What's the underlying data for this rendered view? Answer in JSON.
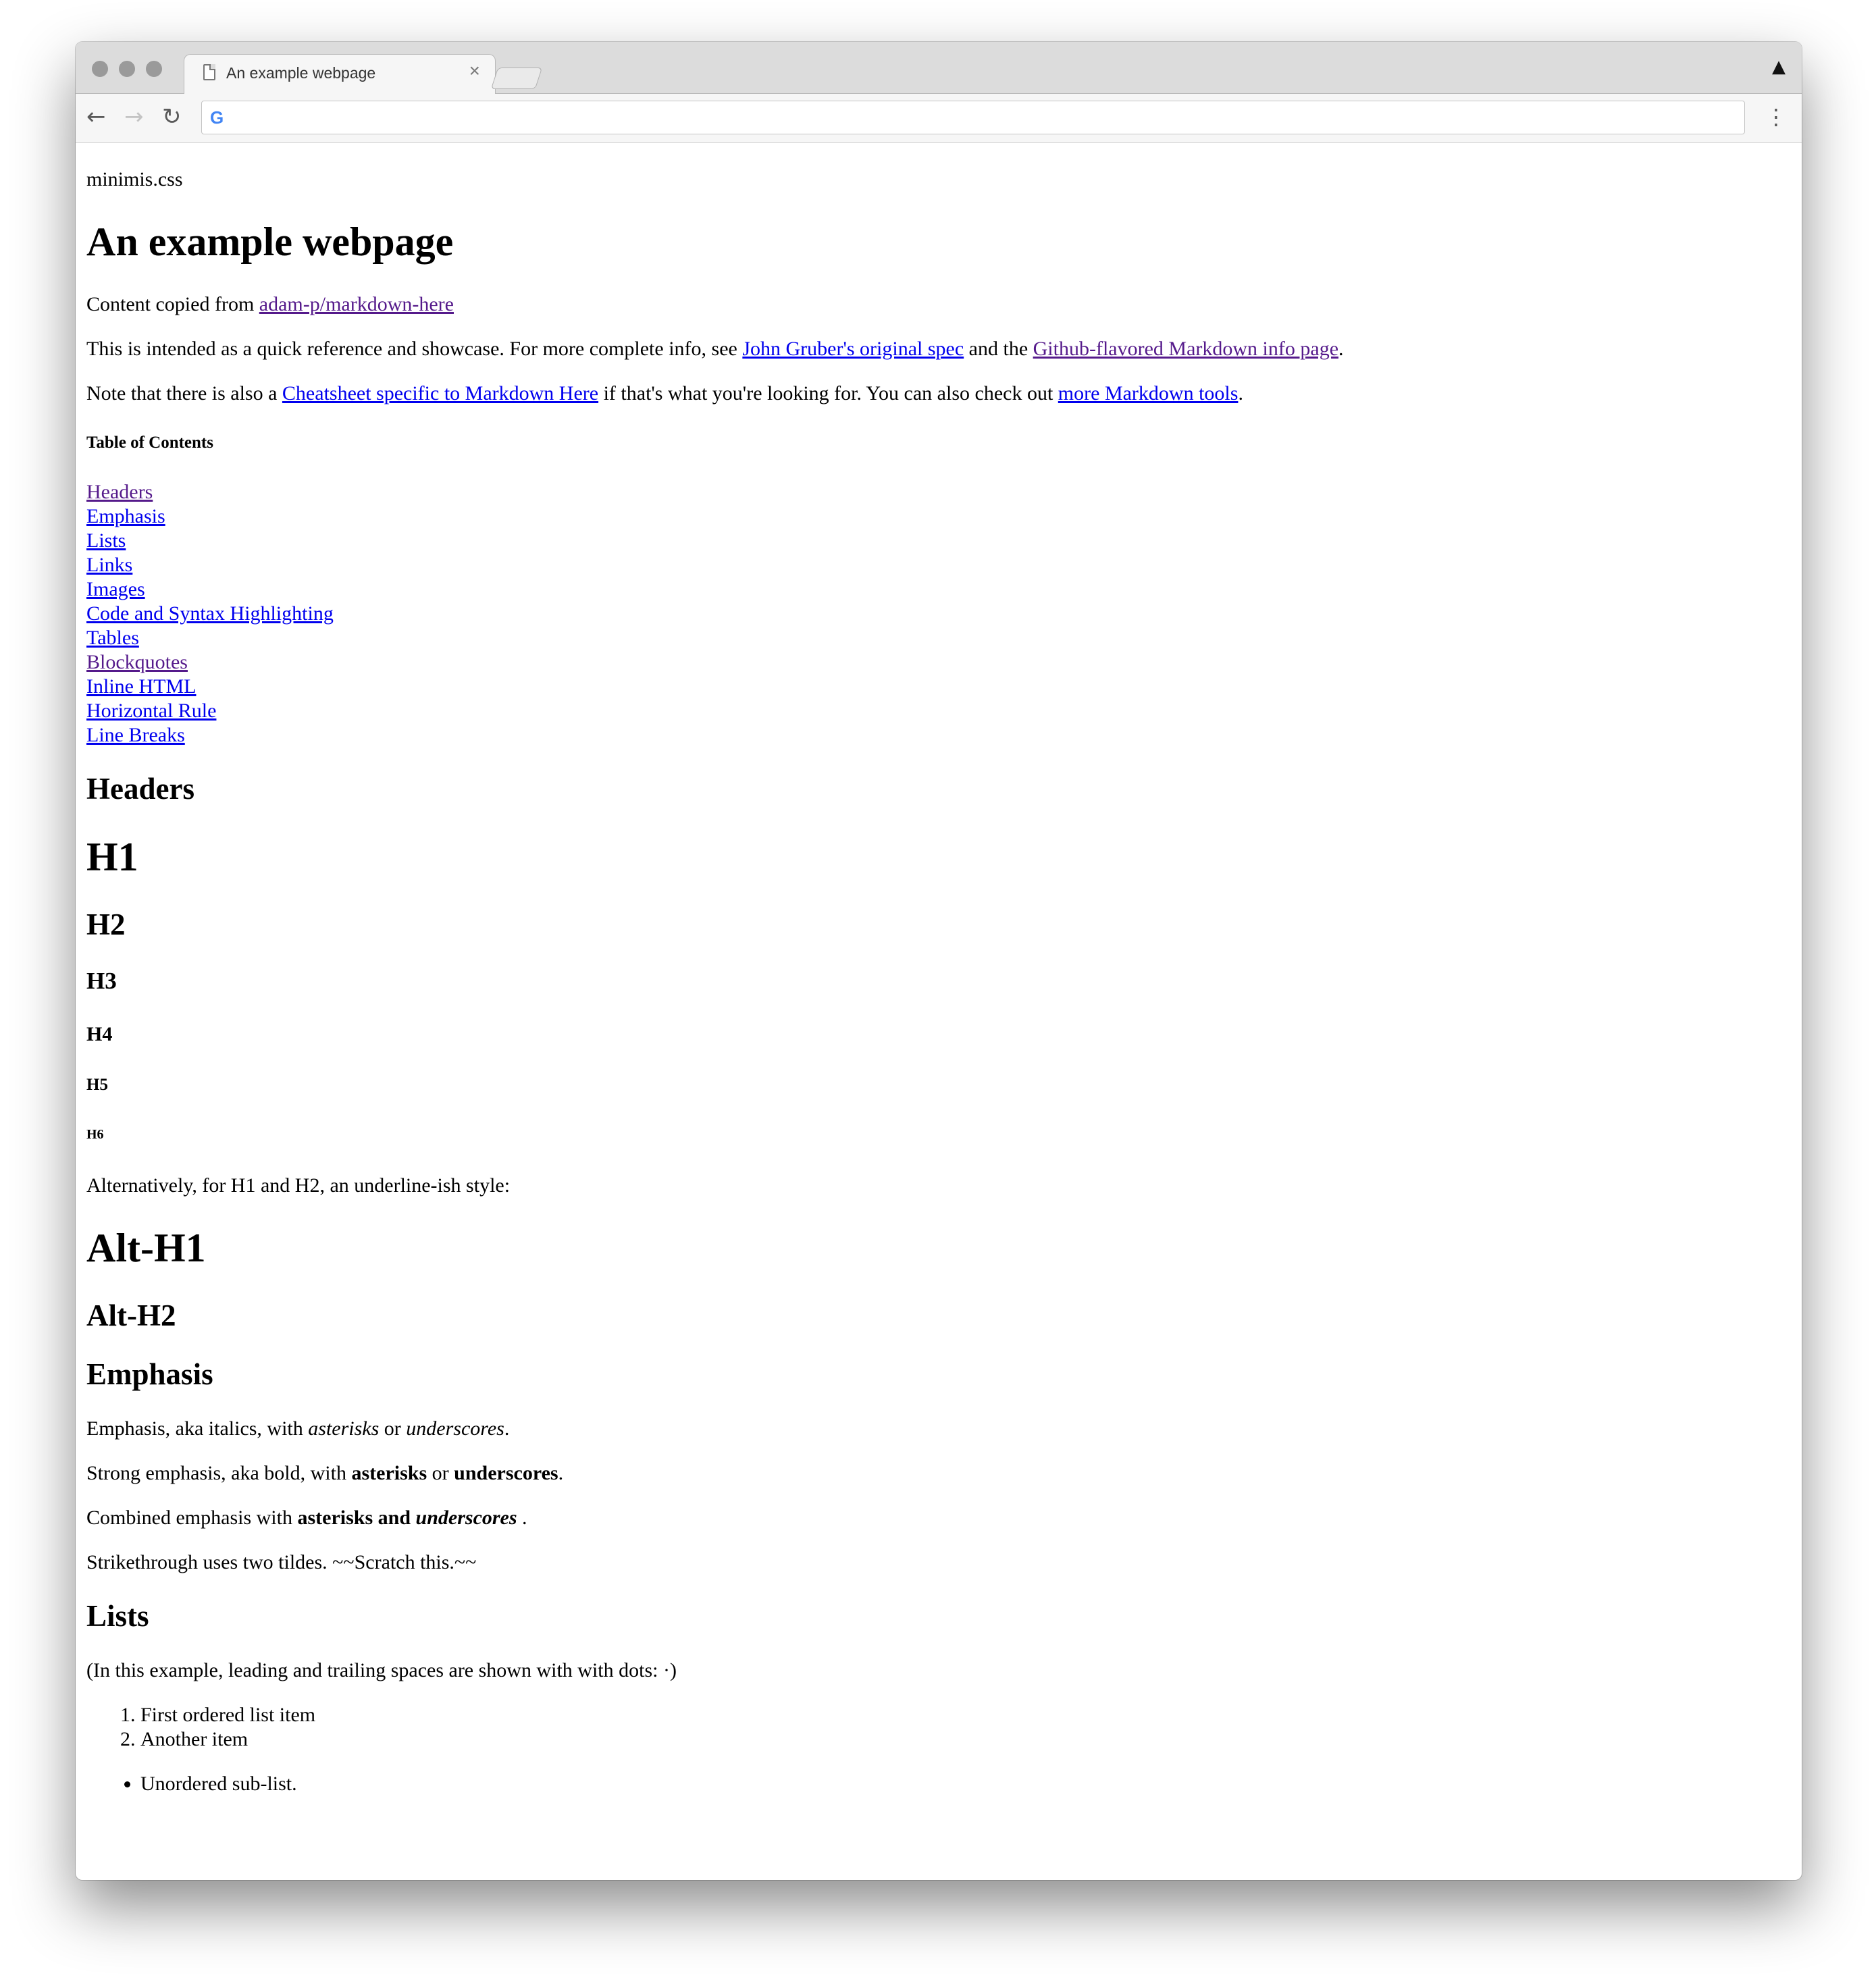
{
  "browser": {
    "tab_title": "An example webpage",
    "tab_close": "×",
    "profile_icon": "▲",
    "back_icon": "←",
    "forward_icon": "→",
    "reload_icon": "↻",
    "menu_icon": "⋮",
    "omnibox_icon": "G",
    "address": ""
  },
  "page": {
    "brand": "minimis.css",
    "title": "An example webpage",
    "copied_prefix": "Content copied from ",
    "copied_link": "adam-p/markdown-here",
    "intro_1": "This is intended as a quick reference and showcase. For more complete info, see ",
    "intro_link_1": "John Gruber's original spec",
    "intro_2": " and the ",
    "intro_link_2": "Github-flavored Markdown info page",
    "intro_3": ".",
    "note_1": "Note that there is also a ",
    "note_link_1": "Cheatsheet specific to Markdown Here",
    "note_2": " if that's what you're looking for. You can also check out ",
    "note_link_2": "more Markdown tools",
    "note_3": ".",
    "toc_heading": "Table of Contents",
    "toc": [
      "Headers",
      "Emphasis",
      "Lists",
      "Links",
      "Images",
      "Code and Syntax Highlighting",
      "Tables",
      "Blockquotes",
      "Inline HTML",
      "Horizontal Rule",
      "Line Breaks"
    ],
    "headers_heading": "Headers",
    "h1": "H1",
    "h2": "H2",
    "h3": "H3",
    "h4": "H4",
    "h5": "H5",
    "h6": "H6",
    "alt_text": "Alternatively, for H1 and H2, an underline-ish style:",
    "alt_h1": "Alt-H1",
    "alt_h2": "Alt-H2",
    "emphasis_heading": "Emphasis",
    "em_1": "Emphasis, aka italics, with ",
    "em_asterisks": "asterisks",
    "em_or": " or ",
    "em_underscores": "underscores",
    "em_end": ".",
    "strong_1": "Strong emphasis, aka bold, with ",
    "strong_asterisks": "asterisks",
    "strong_or": " or ",
    "strong_underscores": "underscores",
    "strong_end": ".",
    "combined_1": "Combined emphasis with ",
    "combined_bold": "asterisks and ",
    "combined_bold_italic": "underscores",
    "combined_end": " .",
    "strike_text": "Strikethrough uses two tildes. ~~Scratch this.~~",
    "lists_heading": "Lists",
    "lists_note": "(In this example, leading and trailing spaces are shown with with dots: ·)",
    "ordered": [
      "First ordered list item",
      "Another item"
    ],
    "unordered": [
      "Unordered sub-list."
    ]
  }
}
